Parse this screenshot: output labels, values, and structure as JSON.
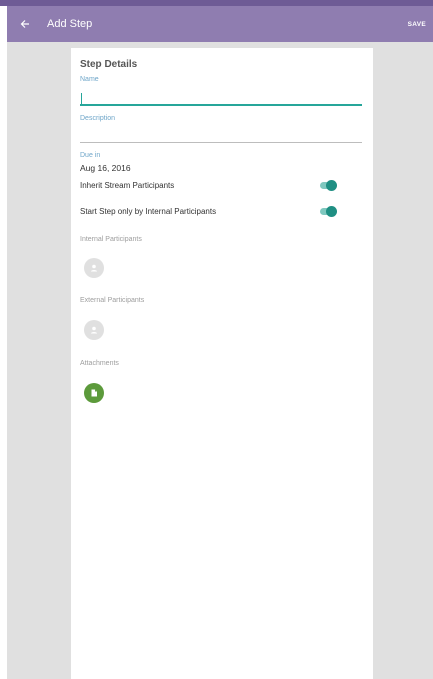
{
  "appbar": {
    "title": "Add Step",
    "save_label": "SAVE",
    "color": "#8f7db0"
  },
  "card": {
    "section_title": "Step Details",
    "name": {
      "label": "Name",
      "value": ""
    },
    "description": {
      "label": "Description",
      "value": ""
    },
    "due": {
      "label": "Due in",
      "value": "Aug 16, 2016"
    },
    "toggles": [
      {
        "label": "Inherit Stream Participants",
        "on": true
      },
      {
        "label": "Start Step only by Internal Participants",
        "on": true
      }
    ],
    "internal_participants": {
      "label": "Internal Participants",
      "icon": "add-person-icon"
    },
    "external_participants": {
      "label": "External Participants",
      "icon": "add-person-icon"
    },
    "attachments": {
      "label": "Attachments",
      "icon": "document-icon"
    }
  },
  "colors": {
    "accent": "#26a69a",
    "toggle_on": "#1f8f83",
    "attachment_green": "#5c9a3b",
    "label_blue": "#6fa6c9"
  }
}
